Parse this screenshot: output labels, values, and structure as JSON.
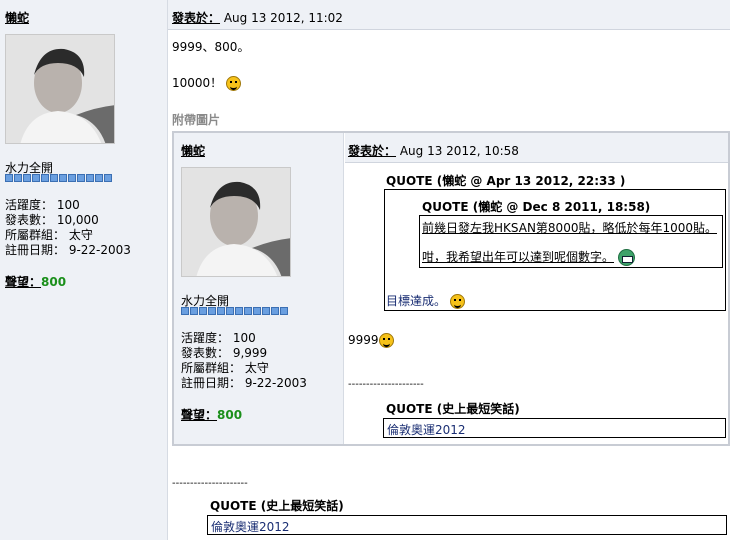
{
  "outer_post": {
    "author": "懶蛇",
    "posted_label": "發表於：",
    "posted_time": "Aug 13 2012, 11:02",
    "user_title": "水力全開",
    "rank_pips": 12,
    "stats": {
      "activity": "活躍度： 100",
      "posts": "發表數： 10,000",
      "group": "所屬群組： 太守",
      "registered": "註冊日期： 9-22-2003"
    },
    "reputation_label": "聲望：",
    "reputation_value": "800",
    "body_line1": "9999、800。",
    "body_line2": "10000！",
    "attachment_label": "附帶圖片",
    "signature_rule": "---------------------",
    "signature_quote_label": "QUOTE (史上最短笑話)",
    "signature_quote_text": "倫敦奧運2012"
  },
  "embedded_post": {
    "author": "懶蛇",
    "posted_label": "發表於：",
    "posted_time": "Aug 13 2012, 10:58",
    "user_title": "水力全開",
    "rank_pips": 12,
    "stats": {
      "activity": "活躍度： 100",
      "posts": "發表數： 9,999",
      "group": "所屬群組： 太守",
      "registered": "註冊日期： 9-22-2003"
    },
    "reputation_label": "聲望：",
    "reputation_value": "800",
    "quote_outer_label": "QUOTE (懶蛇 @ Apr 13 2012, 22:33 )",
    "quote_inner_label": "QUOTE (懶蛇 @ Dec 8 2011, 18:58)",
    "quote_inner_line1": "前幾日發左我HKSAN第8000貼，略低於每年1000貼。",
    "quote_inner_line2": "咁，我希望出年可以達到呢個數字。",
    "quote_outer_reply": "目標達成。",
    "body": "9999",
    "signature_rule": "---------------------",
    "signature_quote_label": "QUOTE (史上最短笑話)",
    "signature_quote_text": "倫敦奧運2012"
  },
  "icons": {
    "smiley": "devil-smiley-icon",
    "grin": "grin-smiley-icon"
  }
}
